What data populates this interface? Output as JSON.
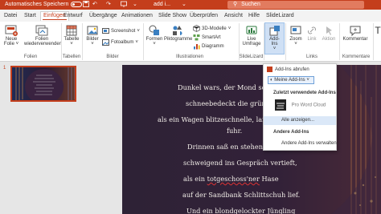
{
  "titlebar": {
    "autosave_label": "Automatisches Speichern",
    "autosave_state": "Aus",
    "document_name": "add i...",
    "search_placeholder": "Suchen"
  },
  "menu": {
    "tabs": [
      "Datei",
      "Start",
      "Einfügen",
      "Entwurf",
      "Übergänge",
      "Animationen",
      "Slide Show",
      "Überprüfen",
      "Ansicht",
      "Hilfe",
      "SlideLizard"
    ],
    "active_tab": "Einfügen"
  },
  "ribbon": {
    "new_slide_line1": "Neue",
    "new_slide_line2": "Folie",
    "reuse_line1": "Folien",
    "reuse_line2": "wiederverwenden",
    "group_slides": "Folien",
    "table": "Tabelle",
    "group_tables": "Tabellen",
    "pictures": "Bilder",
    "screenshot": "Screenshot",
    "photo_album": "Fotoalbum",
    "group_images": "Bilder",
    "shapes": "Formen",
    "icons": "Piktogramme",
    "models_3d": "3D-Modelle",
    "smartart": "SmartArt",
    "chart": "Diagramm",
    "group_illustrations": "Illustrationen",
    "live_poll_line1": "Live",
    "live_poll_line2": "Umfrage",
    "group_slidelizard": "SlideLizard",
    "addins_line1": "Add-",
    "addins_line2": "Ins",
    "zoom": "Zoom",
    "link": "Link",
    "action": "Aktion",
    "group_links": "Links",
    "comment": "Kommentar",
    "group_comments": "Kommentare",
    "text_cut": "T"
  },
  "thumbnail": {
    "number": "1"
  },
  "slide": {
    "lines": [
      "Dunkel wars, der Mond schie",
      "schneebedeckt die grüne F",
      "als ein Wagen blitzeschnelle, langsam",
      "fuhr.",
      "Drinnen saß en stehend Le",
      "schweigend ins Gespräch vertieft,",
      "als ein totgeschoss'ner Hase",
      "auf der Sandbank Schlittschuh lief.",
      "Und ein blondgelockter Jüngling"
    ],
    "underlined_word": "totgeschoss'ner"
  },
  "dropdown": {
    "get_addins": "Add-Ins abrufen",
    "my_addins": "Meine Add-Ins",
    "recent_header": "Zuletzt verwendete Add-Ins",
    "recent_item": "Pro Word Cloud",
    "show_all": "Alle anzeigen...",
    "other_header": "Andere Add-Ins",
    "manage": "Andere Add-Ins verwalten..."
  },
  "colors": {
    "accent": "#c43e1c",
    "selection": "#cfe0f5"
  }
}
